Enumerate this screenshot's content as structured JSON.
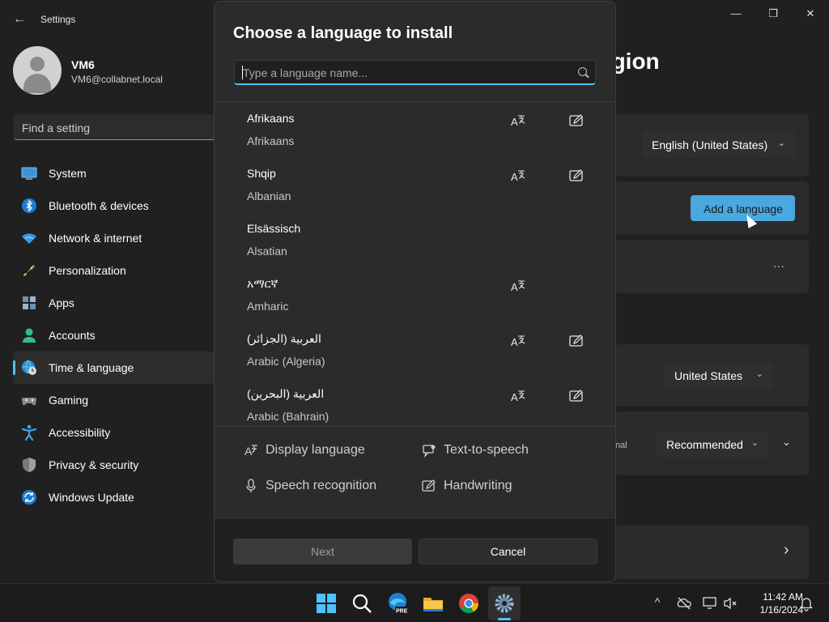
{
  "window": {
    "app_title": "Settings",
    "back_glyph": "←",
    "minimize_glyph": "—",
    "maximize_glyph": "❐",
    "close_glyph": "✕"
  },
  "user": {
    "name": "VM6",
    "email": "VM6@collabnet.local"
  },
  "search": {
    "placeholder": "Find a setting"
  },
  "nav": {
    "items": [
      {
        "label": "System",
        "icon": "system-icon",
        "active": false
      },
      {
        "label": "Bluetooth & devices",
        "icon": "bluetooth-icon",
        "active": false
      },
      {
        "label": "Network & internet",
        "icon": "wifi-icon",
        "active": false
      },
      {
        "label": "Personalization",
        "icon": "brush-icon",
        "active": false
      },
      {
        "label": "Apps",
        "icon": "apps-icon",
        "active": false
      },
      {
        "label": "Accounts",
        "icon": "accounts-icon",
        "active": false
      },
      {
        "label": "Time & language",
        "icon": "globe-clock-icon",
        "active": true
      },
      {
        "label": "Gaming",
        "icon": "gamepad-icon",
        "active": false
      },
      {
        "label": "Accessibility",
        "icon": "accessibility-icon",
        "active": false
      },
      {
        "label": "Privacy & security",
        "icon": "shield-icon",
        "active": false
      },
      {
        "label": "Windows Update",
        "icon": "update-icon",
        "active": false
      }
    ]
  },
  "background_page": {
    "title_partial": "egion",
    "display_language_value": "English (United States)",
    "add_language_label": "Add a language",
    "more_glyph": "···",
    "country_value": "United States",
    "regional_label_partial": "nal",
    "regional_format_value": "Recommended",
    "chevron_glyph": "›"
  },
  "dialog": {
    "title": "Choose a language to install",
    "search_placeholder": "Type a language name...",
    "languages": [
      {
        "native": "Afrikaans",
        "english": "Afrikaans",
        "display": true,
        "handwriting": true
      },
      {
        "native": "Shqip",
        "english": "Albanian",
        "display": true,
        "handwriting": true
      },
      {
        "native": "Elsässisch",
        "english": "Alsatian",
        "display": false,
        "handwriting": false
      },
      {
        "native": "አማርኛ",
        "english": "Amharic",
        "display": true,
        "handwriting": false
      },
      {
        "native": "العربية (الجزائر)",
        "english": "Arabic (Algeria)",
        "display": true,
        "handwriting": true
      },
      {
        "native": "العربية (البحرين)",
        "english": "Arabic (Bahrain)",
        "display": true,
        "handwriting": true
      }
    ],
    "legend": {
      "display_language": "Display language",
      "text_to_speech": "Text-to-speech",
      "speech_recognition": "Speech recognition",
      "handwriting": "Handwriting"
    },
    "next_label": "Next",
    "cancel_label": "Cancel"
  },
  "taskbar": {
    "icons": [
      "windows-start-icon",
      "search-icon",
      "edge-beta-icon",
      "file-explorer-icon",
      "chrome-icon",
      "settings-gear-icon"
    ],
    "edge_badge": "PRE",
    "tray_chevron": "^",
    "time": "11:42 AM",
    "date": "1/16/2024"
  },
  "colors": {
    "accent": "#4cc2ff",
    "button_accent": "#4aa8e0",
    "background": "#202020",
    "dialog": "#2b2b2b"
  }
}
